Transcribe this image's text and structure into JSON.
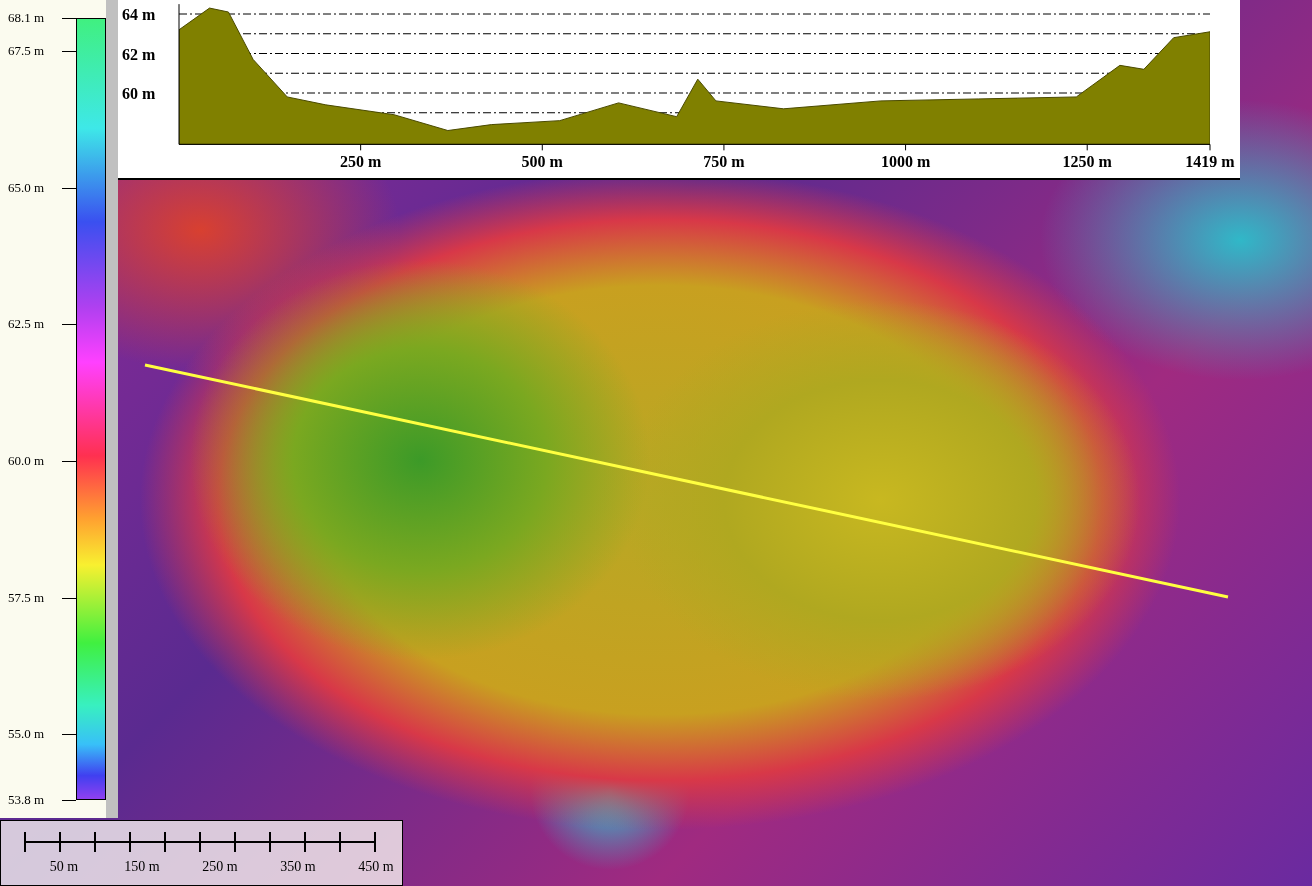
{
  "legend": {
    "labels": [
      "68.1 m",
      "67.5 m",
      "65.0 m",
      "62.5 m",
      "60.0 m",
      "57.5 m",
      "55.0 m",
      "53.8 m"
    ]
  },
  "profile": {
    "chart_data": {
      "type": "area",
      "grid": true,
      "x": [
        0,
        42,
        68,
        102,
        149,
        202,
        296,
        370,
        430,
        524,
        605,
        685,
        714,
        739,
        832,
        966,
        1100,
        1235,
        1295,
        1328,
        1369,
        1419
      ],
      "series": [
        {
          "color": "#808000",
          "values": [
            63.2,
            64.3,
            64.1,
            61.7,
            59.8,
            59.4,
            58.9,
            58.1,
            58.4,
            58.6,
            59.5,
            58.8,
            60.7,
            59.6,
            59.2,
            59.6,
            59.7,
            59.8,
            61.4,
            61.2,
            62.8,
            63.1
          ]
        }
      ],
      "xlim": [
        0,
        1419
      ],
      "ylim": [
        57.4,
        64.5
      ],
      "xticks": [
        {
          "value": 250,
          "label": "250 m"
        },
        {
          "value": 500,
          "label": "500 m"
        },
        {
          "value": 750,
          "label": "750 m"
        },
        {
          "value": 1000,
          "label": "1000 m"
        },
        {
          "value": 1250,
          "label": "1250 m"
        },
        {
          "value": 1419,
          "label": "1419 m"
        }
      ],
      "yticks": [
        {
          "value": 60,
          "label": "60 m"
        },
        {
          "value": 62,
          "label": "62 m"
        },
        {
          "value": 64,
          "label": "64 m"
        }
      ]
    }
  },
  "scale_bar": {
    "labels": [
      "50 m",
      "150 m",
      "250 m",
      "350 m",
      "450 m"
    ]
  }
}
